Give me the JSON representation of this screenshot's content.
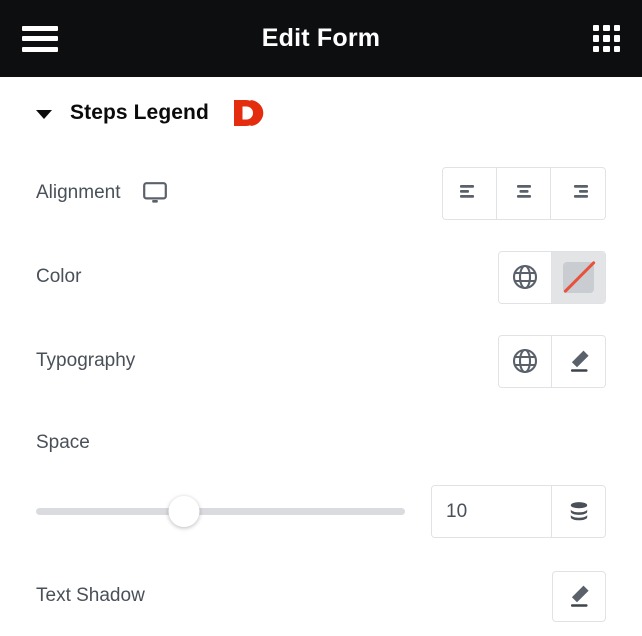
{
  "header": {
    "title": "Edit Form",
    "menu_icon": "hamburger-icon",
    "apps_icon": "grid-apps-icon"
  },
  "section": {
    "title": "Steps Legend",
    "collapse_icon": "chevron-down-icon",
    "brand_logo": "droit-d-logo",
    "brand_color": "#E42D0E"
  },
  "controls": {
    "alignment": {
      "label": "Alignment",
      "device_icon": "desktop-icon",
      "options": [
        {
          "value": "left",
          "icon": "align-left-icon"
        },
        {
          "value": "center",
          "icon": "align-center-icon"
        },
        {
          "value": "right",
          "icon": "align-right-icon"
        }
      ],
      "selected": ""
    },
    "color": {
      "label": "Color",
      "globe_icon": "globe-icon",
      "swatch_icon": "no-color-swatch",
      "value": "",
      "strike_color": "#E8513B"
    },
    "typography": {
      "label": "Typography",
      "globe_icon": "globe-icon",
      "edit_icon": "pencil-edit-icon"
    },
    "space": {
      "label": "Space",
      "value": "10",
      "placeholder": "",
      "slider_percent": 40,
      "unit_icon": "database-stack-icon"
    },
    "text_shadow": {
      "label": "Text Shadow",
      "edit_icon": "pencil-edit-icon"
    }
  }
}
